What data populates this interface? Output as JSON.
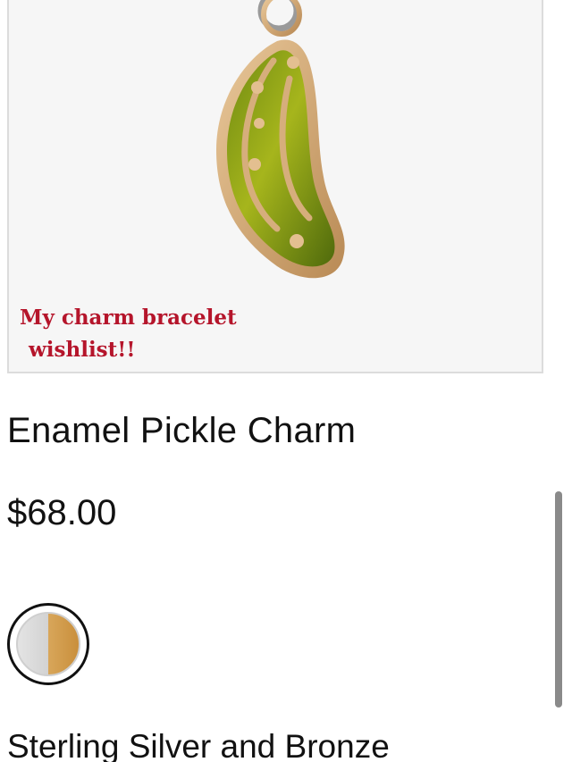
{
  "product": {
    "title": "Enamel Pickle Charm",
    "price": "$68.00",
    "variant_name": "Sterling Silver and Bronze",
    "swatch_colors": {
      "silver": "#d6d6d6",
      "bronze": "#d09a4c"
    }
  },
  "image_overlay": {
    "line1": "My charm bracelet",
    "line2": "wishlist!!",
    "color": "#b5152b"
  },
  "icons": {
    "product_image": "pickle-charm-image",
    "swatch": "silver-bronze-swatch-icon"
  }
}
